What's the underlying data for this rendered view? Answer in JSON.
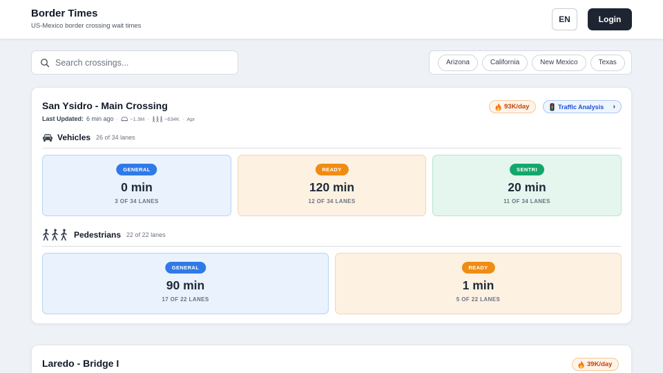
{
  "header": {
    "title": "Border Times",
    "subtitle": "US-Mexico border crossing wait times",
    "language": "EN",
    "login": "Login"
  },
  "search": {
    "placeholder": "Search crossings..."
  },
  "filters": [
    "Arizona",
    "California",
    "New Mexico",
    "Texas"
  ],
  "crossings": [
    {
      "name": "San Ysidro - Main Crossing",
      "last_updated_label": "Last Updated:",
      "last_updated": "6 min ago",
      "vehicle_stat": "~1.3M",
      "pedestrian_stat": "~634K",
      "month": "Apr",
      "traffic": "93K/day",
      "analysis": "Traffic Analysis",
      "vehicles": {
        "title": "Vehicles",
        "lanes": "26 of 34 lanes",
        "lanes_open": 26,
        "lanes_total": 34,
        "boxes": [
          {
            "label": "GENERAL",
            "time": "0 min",
            "lanes": "3 OF 34 LANES"
          },
          {
            "label": "READY",
            "time": "120 min",
            "lanes": "12 OF 34 LANES"
          },
          {
            "label": "SENTRI",
            "time": "20 min",
            "lanes": "11 OF 34 LANES"
          }
        ]
      },
      "pedestrians": {
        "title": "Pedestrians",
        "lanes": "22 of 22 lanes",
        "boxes": [
          {
            "label": "GENERAL",
            "time": "90 min",
            "lanes": "17 OF 22 LANES"
          },
          {
            "label": "READY",
            "time": "1 min",
            "lanes": "5 OF 22 LANES"
          }
        ]
      }
    },
    {
      "name": "Laredo - Bridge I",
      "traffic": "39K/day"
    }
  ],
  "colors": {
    "general": "#2f7ae8",
    "ready": "#f08c12",
    "sentri": "#13a86b",
    "login_bg": "#1e2532"
  },
  "icons": [
    "search-icon",
    "fire-icon",
    "traffic-light-icon",
    "chevron-right-icon",
    "car-icon",
    "pedestrian-icon"
  ]
}
